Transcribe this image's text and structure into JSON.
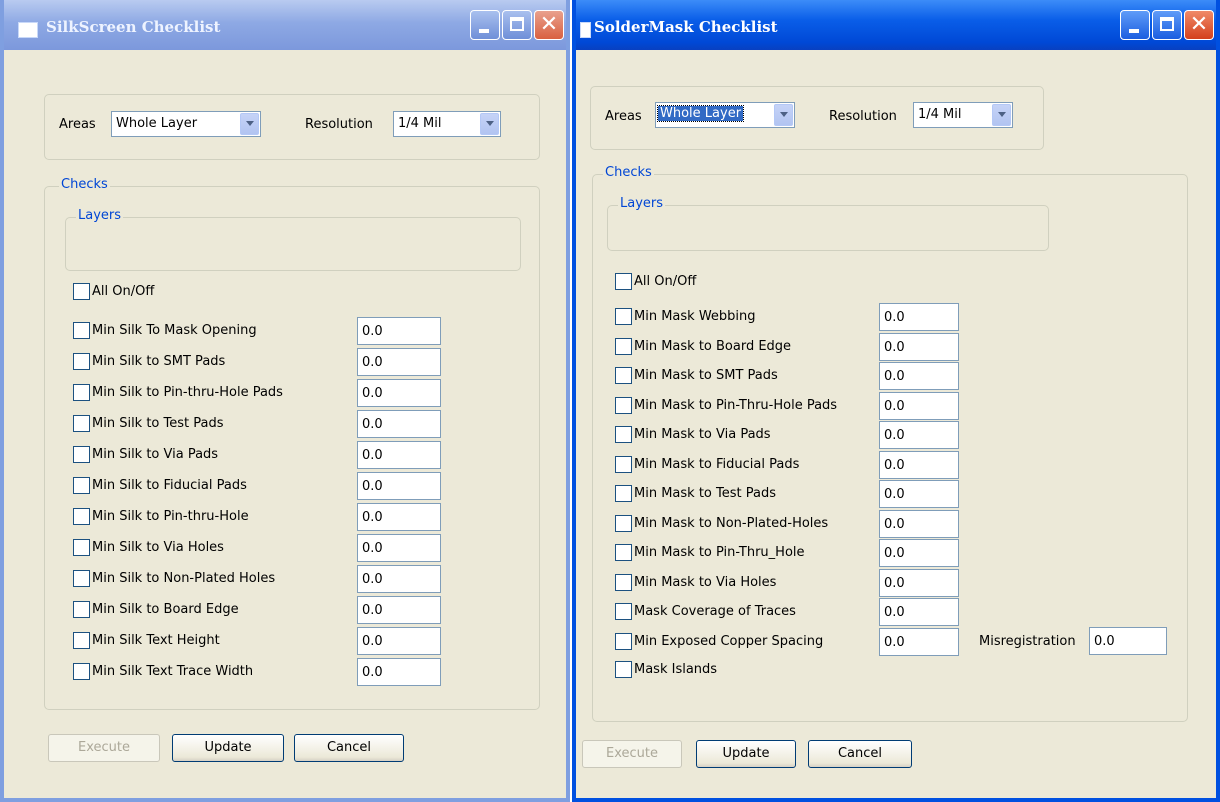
{
  "silk": {
    "title": "SilkScreen Checklist",
    "areas_label": "Areas",
    "areas_value": "Whole Layer",
    "resolution_label": "Resolution",
    "resolution_value": "1/4 Mil",
    "checks_label": "Checks",
    "layers_label": "Layers",
    "all_label": "All On/Off",
    "items": [
      {
        "label": "Min Silk To Mask Opening",
        "value": "0.0"
      },
      {
        "label": "Min Silk  to SMT Pads",
        "value": "0.0"
      },
      {
        "label": "Min Silk to  Pin-thru-Hole Pads",
        "value": "0.0"
      },
      {
        "label": "Min Silk to Test Pads",
        "value": "0.0"
      },
      {
        "label": "Min Silk to Via Pads",
        "value": "0.0"
      },
      {
        "label": "Min Silk to Fiducial Pads",
        "value": "0.0"
      },
      {
        "label": "Min Silk to Pin-thru-Hole",
        "value": "0.0"
      },
      {
        "label": "Min Silk to Via Holes",
        "value": "0.0"
      },
      {
        "label": "Min Silk to Non-Plated Holes",
        "value": "0.0"
      },
      {
        "label": "Min Silk to Board Edge",
        "value": "0.0"
      },
      {
        "label": "Min Silk Text Height",
        "value": "0.0"
      },
      {
        "label": "Min Silk Text Trace Width",
        "value": "0.0"
      }
    ],
    "execute_label": "Execute",
    "update_label": "Update",
    "cancel_label": "Cancel"
  },
  "mask": {
    "title": "SolderMask Checklist",
    "areas_label": "Areas",
    "areas_value": "Whole Layer",
    "resolution_label": "Resolution",
    "resolution_value": "1/4 Mil",
    "checks_label": "Checks",
    "layers_label": "Layers",
    "all_label": "All On/Off",
    "items": [
      {
        "label": "Min Mask Webbing",
        "value": "0.0"
      },
      {
        "label": "Min Mask to Board Edge",
        "value": "0.0"
      },
      {
        "label": "Min Mask to SMT Pads",
        "value": "0.0"
      },
      {
        "label": "Min Mask to Pin-Thru-Hole Pads",
        "value": "0.0"
      },
      {
        "label": "Min Mask to Via Pads",
        "value": "0.0"
      },
      {
        "label": "Min Mask to Fiducial Pads",
        "value": "0.0"
      },
      {
        "label": "Min Mask to Test Pads",
        "value": "0.0"
      },
      {
        "label": "Min Mask to Non-Plated-Holes",
        "value": "0.0"
      },
      {
        "label": "Min Mask to  Pin-Thru_Hole",
        "value": "0.0"
      },
      {
        "label": "Min Mask to Via Holes",
        "value": "0.0"
      },
      {
        "label": "Mask Coverage of Traces",
        "value": "0.0"
      },
      {
        "label": "Min Exposed Copper Spacing",
        "value": "0.0"
      }
    ],
    "misregistration_label": "Misregistration",
    "misregistration_value": "0.0",
    "islands_label": "Mask Islands",
    "execute_label": "Execute",
    "update_label": "Update",
    "cancel_label": "Cancel"
  }
}
